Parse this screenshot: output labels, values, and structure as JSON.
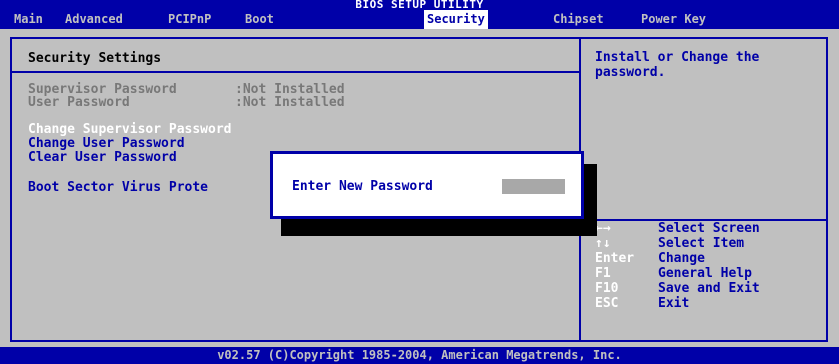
{
  "title": "BIOS SETUP UTILITY",
  "menu": [
    {
      "label": "Main",
      "active": false
    },
    {
      "label": "Advanced",
      "active": false
    },
    {
      "label": "PCIPnP",
      "active": false
    },
    {
      "label": "Boot",
      "active": false
    },
    {
      "label": "Security",
      "active": true
    },
    {
      "label": "Chipset",
      "active": false
    },
    {
      "label": "Power Key",
      "active": false
    }
  ],
  "section_title": "Security Settings",
  "status": [
    {
      "label": "Supervisor Password",
      "value": ":Not Installed"
    },
    {
      "label": "User Password",
      "value": ":Not Installed"
    }
  ],
  "options": [
    "Change Supervisor Password",
    "Change User Password",
    "Clear User Password",
    "Boot Sector Virus Prote"
  ],
  "help": "Install or Change the password.",
  "keys": [
    {
      "key": "←→",
      "desc": "Select Screen"
    },
    {
      "key": "↑↓",
      "desc": "Select Item"
    },
    {
      "key": "Enter",
      "desc": "Change"
    },
    {
      "key": "F1",
      "desc": "General Help"
    },
    {
      "key": "F10",
      "desc": "Save and Exit"
    },
    {
      "key": "ESC",
      "desc": "Exit"
    }
  ],
  "popup": {
    "label": "Enter New Password",
    "field_value": ""
  },
  "footer": "v02.57 (C)Copyright 1985-2004, American Megatrends, Inc.",
  "colors": {
    "background": "#c0c0c0",
    "accent_blue": "#0000a8",
    "highlight_white": "#ffffff",
    "dim_gray": "#787878"
  }
}
